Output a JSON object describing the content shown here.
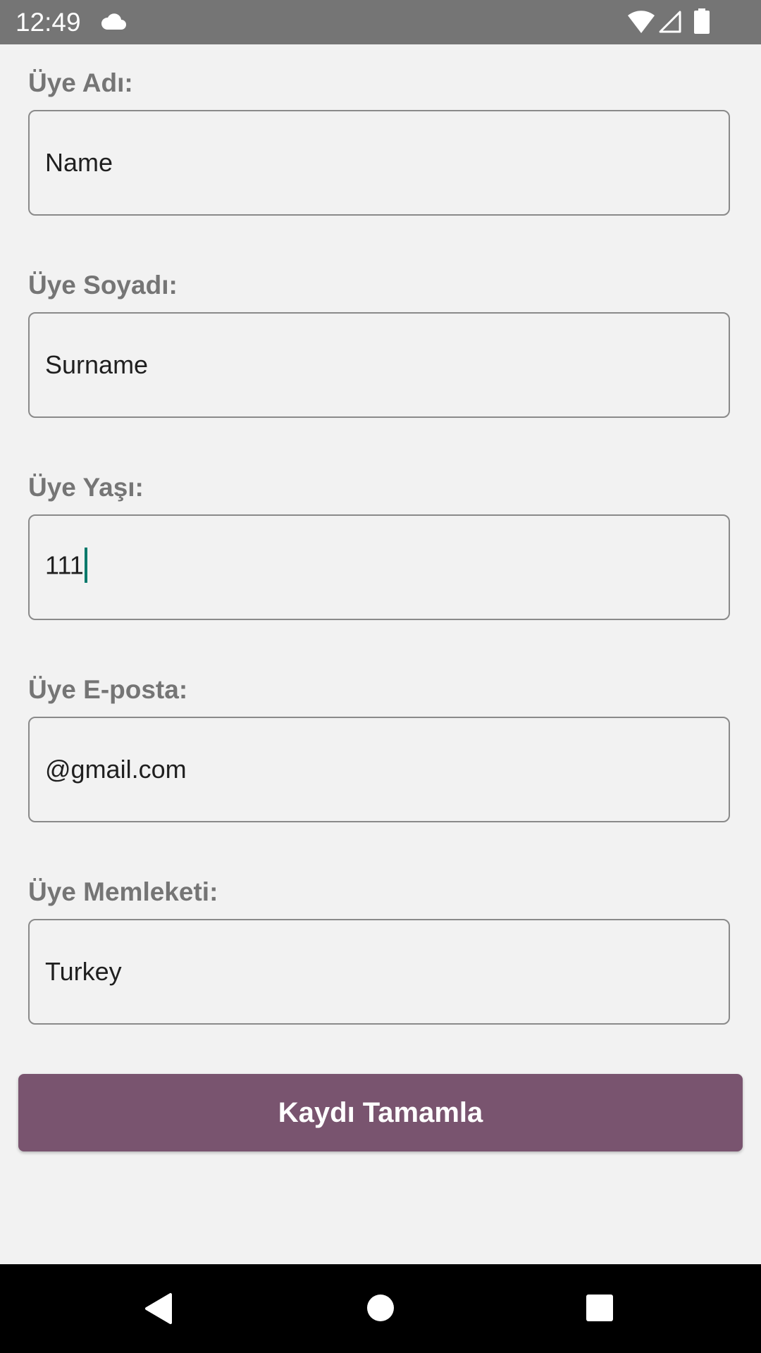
{
  "status_bar": {
    "time": "12:49",
    "icons": [
      "cloud-icon",
      "wifi-icon",
      "signal-icon",
      "battery-icon"
    ]
  },
  "form": {
    "fields": [
      {
        "label": "Üye Adı:",
        "value": "Name"
      },
      {
        "label": "Üye Soyadı:",
        "value": "Surname"
      },
      {
        "label": "Üye Yaşı:",
        "value": "111"
      },
      {
        "label": "Üye E-posta:",
        "value": "@gmail.com"
      },
      {
        "label": "Üye Memleketi:",
        "value": "Turkey"
      }
    ],
    "submit_label": "Kaydı Tamamla"
  },
  "navigation_bar": {
    "icons": [
      "back-icon",
      "home-icon",
      "recents-icon"
    ]
  },
  "colors": {
    "status_bar": "#757575",
    "background": "#f2f2f2",
    "label_text": "#757575",
    "field_border": "#8a8a8a",
    "button": "#79546f",
    "cursor": "#00796b",
    "nav_bar": "#000000"
  }
}
